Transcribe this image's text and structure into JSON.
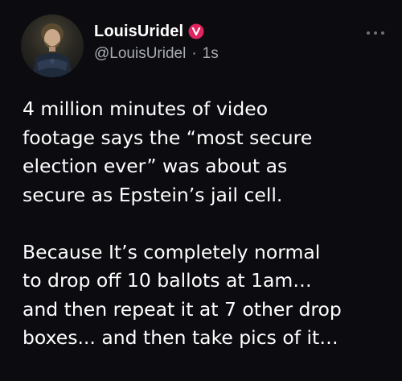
{
  "author": {
    "display_name": "LouisUridel",
    "handle": "@LouisUridel",
    "separator": "·",
    "timestamp": "1s",
    "verified_icon": "verified-badge-icon",
    "verified_color": "#e0245e",
    "avatar_icon": "profile-photo"
  },
  "menu": {
    "icon": "more-options-icon"
  },
  "tweet": {
    "paragraph_1": [
      "4 million minutes of video",
      "footage says the “most secure",
      "election ever” was about as",
      "secure as Epstein’s jail cell."
    ],
    "paragraph_2": [
      "Because It’s completely normal",
      "to drop off 10 ballots at 1am…",
      "and then repeat it at 7 other drop",
      "boxes... and then take pics of it…"
    ]
  },
  "colors": {
    "background": "#0b0b10",
    "text_primary": "#ffffff",
    "text_secondary": "#a9acb3"
  }
}
